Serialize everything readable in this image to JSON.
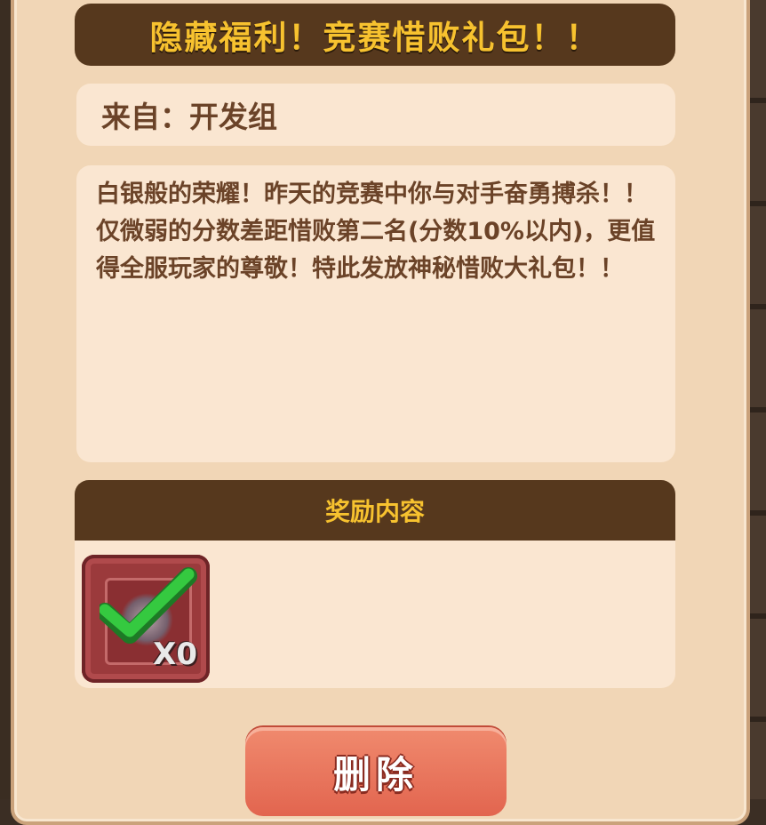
{
  "mail": {
    "title": "隐藏福利！竞赛惜败礼包！！",
    "from": "来自：开发组",
    "body": "白银般的荣耀！昨天的竞赛中你与对手奋勇搏杀！！仅微弱的分数差距惜败第二名(分数10%以内)，更值得全服玩家的尊敬！特此发放神秘惜败大礼包！！"
  },
  "rewards": {
    "header": "奖励内容",
    "items": [
      {
        "icon": "gift-pack-icon",
        "quantity": "X0",
        "claimed": true
      }
    ]
  },
  "actions": {
    "delete_label": "删除"
  },
  "colors": {
    "title_bar": "#56381d",
    "title_text": "#f7c22f",
    "panel": "#f1d6b6",
    "text": "#6b4328",
    "delete_button": "#e2654f",
    "check": "#2fbf3a"
  }
}
